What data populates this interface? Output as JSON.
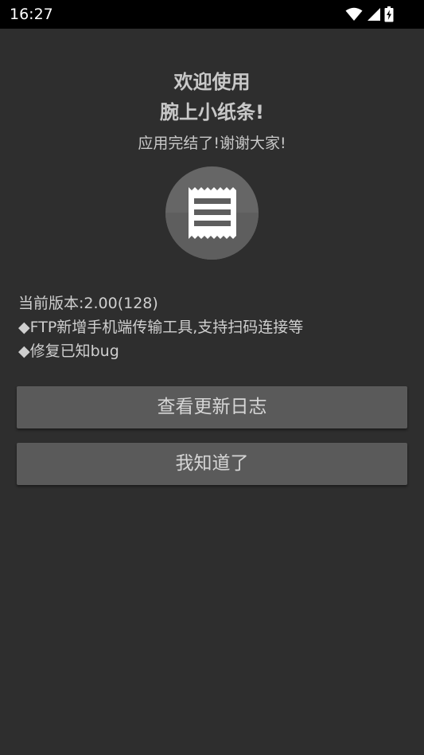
{
  "status_bar": {
    "time": "16:27",
    "icons": [
      "wifi-icon",
      "signal-icon",
      "battery-charging-icon"
    ]
  },
  "dialog": {
    "welcome_line1": "欢迎使用",
    "welcome_line2": "腕上小纸条!",
    "subtitle": "应用完结了!谢谢大家!",
    "logo_icon": "receipt-icon",
    "version_line": "当前版本:2.00(128)",
    "changes": [
      "◆FTP新增手机端传输工具,支持扫码连接等",
      "◆修复已知bug"
    ],
    "changelog_button": "查看更新日志",
    "ok_button": "我知道了"
  },
  "colors": {
    "background": "#2e2e2e",
    "status_bar": "#000000",
    "button": "#5a5a5a",
    "logo_circle": "#666666",
    "text": "#cfcfcf"
  }
}
